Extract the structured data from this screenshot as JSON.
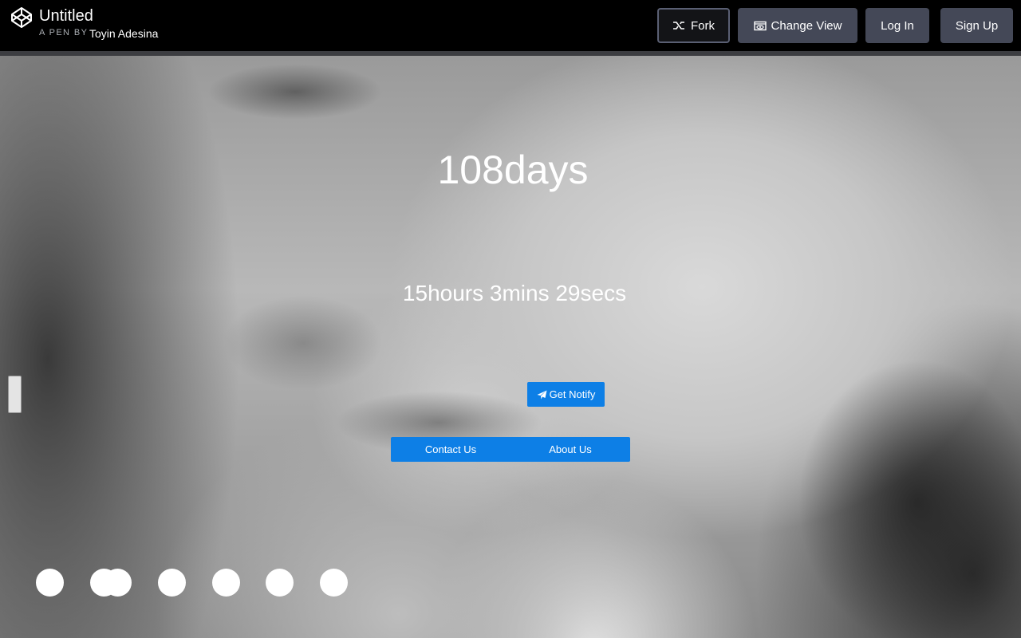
{
  "header": {
    "title": "Untitled",
    "pen_by": "A PEN BY",
    "author": "Toyin Adesina",
    "buttons": {
      "fork": "Fork",
      "change_view": "Change View",
      "login": "Log In",
      "signup": "Sign Up"
    }
  },
  "countdown": {
    "days": "108days",
    "time": "15hours 3mins 29secs"
  },
  "actions": {
    "notify": "Get Notify"
  },
  "nav": {
    "contact": "Contact Us",
    "about": "About Us"
  },
  "social": [
    "social-link-1",
    "social-link-2",
    "social-link-3",
    "social-link-4",
    "social-link-5",
    "social-link-6",
    "social-link-7"
  ],
  "colors": {
    "accent": "#0d7fe6",
    "header_bg": "#000000",
    "header_button": "#444857"
  }
}
